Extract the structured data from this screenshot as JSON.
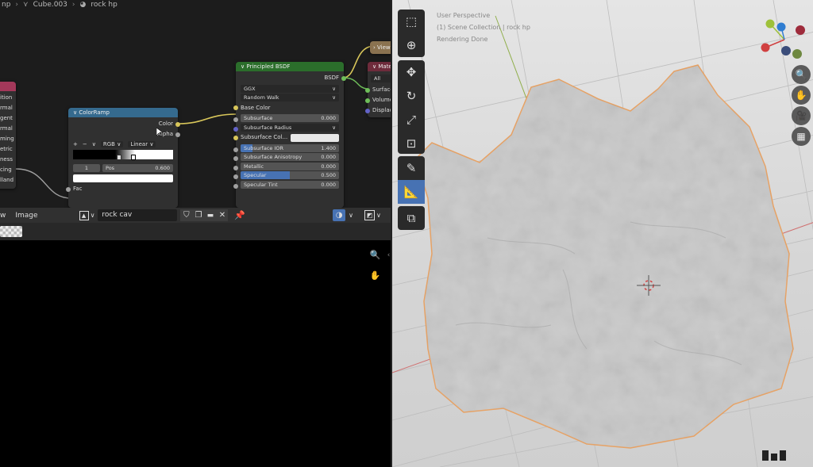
{
  "breadcrumb": {
    "prefix": "np",
    "object": "Cube.003",
    "material": "rock hp"
  },
  "colorramp": {
    "title": "ColorRamp",
    "out_color": "Color",
    "out_alpha": "Alpha",
    "plus": "+",
    "minus": "−",
    "chevron": "∨",
    "mode": "RGB",
    "interpolation": "Linear",
    "index": "1",
    "pos_label": "Pos",
    "pos_value": "0.600",
    "input_fac": "Fac"
  },
  "partial_node": {
    "labels": [
      "ition",
      "rmal",
      "gent",
      "rmal",
      "ming",
      "etric",
      "ness",
      "cing",
      "lland"
    ]
  },
  "principled": {
    "title": "Principled BSDF",
    "output": "BSDF",
    "distribution": "GGX",
    "subsurface_method": "Random Walk",
    "base_color": "Base Color",
    "subsurface": {
      "label": "Subsurface",
      "value": "0.000"
    },
    "subsurface_radius": "Subsurface Radius",
    "subsurface_col": "Subsurface Col...",
    "subsurface_ior": {
      "label": "Subsurface IOR",
      "value": "1.400"
    },
    "subsurface_aniso": {
      "label": "Subsurface Anisotropy",
      "value": "0.000"
    },
    "metallic": {
      "label": "Metallic",
      "value": "0.000"
    },
    "specular": {
      "label": "Specular",
      "value": "0.500"
    },
    "specular_tint": {
      "label": "Specular Tint",
      "value": "0.000"
    }
  },
  "material_output": {
    "title": "Mate",
    "target": "All",
    "surface": "Surface",
    "volume": "Volume",
    "displacement": "Displace"
  },
  "viewer_node": {
    "title": "View"
  },
  "image_editor": {
    "view_menu": "w",
    "image_menu": "Image",
    "image_name": "rock cav"
  },
  "viewport": {
    "line1": "User Perspective",
    "line2": "(1) Scene Collection | rock hp",
    "line3": "Rendering Done"
  },
  "colors": {
    "accent": "#4772b3",
    "node_header_green": "#2b6e2b",
    "colorramp_header": "#356a8e",
    "object_outline": "#e8a060"
  }
}
